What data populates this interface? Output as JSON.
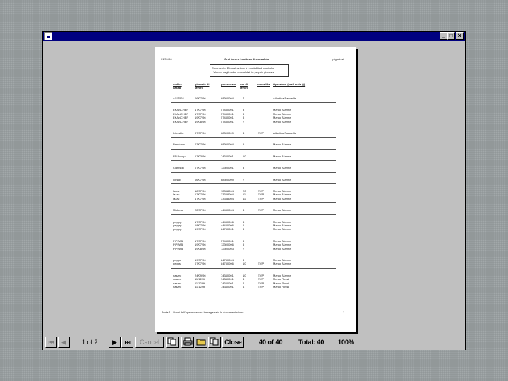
{
  "window": {
    "controls": {
      "minimize": "_",
      "maximize": "□",
      "close": "✕"
    }
  },
  "report": {
    "date": "01/01/96",
    "title": "Ordi lavoro in attesa di convalida",
    "code": "rptguaissi",
    "note_line1": "Commento: Dimostrazione in modalità di controllo",
    "note_line2": "L'elenco degli ordini convalidati in proprio giornata",
    "headers": {
      "code": "codice cassa",
      "day": "giornata di lavoro",
      "process": "processato",
      "hours": "ore di lavoro",
      "validated": "convalida",
      "operator": "Operatore (reali mais ())"
    },
    "groups": [
      {
        "rows": [
          [
            "ACIT564",
            "06/07/96",
            "68300004",
            "7",
            "",
            "Atlantica Panqelite"
          ]
        ]
      },
      {
        "rows": [
          [
            "EKANCHEP",
            "17/07/96",
            "57430001",
            "3",
            "",
            "Marco Allarme"
          ],
          [
            "EKANCHEP",
            "17/07/96",
            "57430001",
            "8",
            "",
            "Marco Allarme"
          ],
          [
            "EKANCHEP",
            "19/07/96",
            "57430001",
            "8",
            "",
            "Marco Allarme"
          ],
          [
            "EKANCHEP",
            "19/08/96",
            "57430001",
            "7",
            "",
            "Marco Allarme"
          ]
        ]
      },
      {
        "rows": [
          [
            "Interakte",
            "07/07/96",
            "68300009",
            "4",
            "EVIP",
            "Atlantica Panqelite"
          ]
        ]
      },
      {
        "rows": [
          [
            "Pandoras",
            "07/07/96",
            "68300004",
            "5",
            "",
            "Marco Allarme"
          ]
        ]
      },
      {
        "rows": [
          [
            "FRIAccep",
            "17/03/96",
            "74340001",
            "10",
            "",
            "Marco Allarme"
          ]
        ]
      },
      {
        "rows": [
          [
            "Clarkson",
            "07/07/96",
            "12300001",
            "3",
            "",
            "Marco Allarme"
          ]
        ]
      },
      {
        "rows": [
          [
            "Ivesrig",
            "06/07/96",
            "68300009",
            "7",
            "",
            "Marco Allarme"
          ]
        ]
      },
      {
        "rows": [
          [
            "Iazaz",
            "18/07/96",
            "12338004",
            "20",
            "EVIP",
            "Marco Allarme"
          ],
          [
            "Iazaz",
            "17/07/96",
            "33338004",
            "11",
            "EVIP",
            "Marco Allarme"
          ],
          [
            "Iazaz",
            "17/07/96",
            "33338004",
            "11",
            "EVIP",
            "Marco Allarme"
          ]
        ]
      },
      {
        "rows": [
          [
            "Mikkeus",
            "22/07/96",
            "44430004",
            "4",
            "EVIP",
            "Marco Allarme"
          ]
        ]
      },
      {
        "rows": [
          [
            "pepprp",
            "17/07/96",
            "44430006",
            "4",
            "",
            "Marco Allarme"
          ],
          [
            "pepprp",
            "18/07/96",
            "44430006",
            "6",
            "",
            "Marco Allarme"
          ],
          [
            "pepprp",
            "19/07/96",
            "84730001",
            "3",
            "",
            "Marco Allarme"
          ]
        ]
      },
      {
        "rows": [
          [
            "PIPPAB",
            "17/07/96",
            "57430001",
            "3",
            "",
            "Marco Allarme"
          ],
          [
            "PIPPAB",
            "19/07/96",
            "12300006",
            "5",
            "",
            "Marco Allarme"
          ],
          [
            "PIPPAB",
            "19/08/96",
            "12300003",
            "7",
            "",
            "Marco Allarme"
          ]
        ]
      },
      {
        "rows": [
          [
            "pepps",
            "19/07/96",
            "84730004",
            "3",
            "",
            "Marco Allarme"
          ],
          [
            "pepps",
            "07/07/96",
            "84730006",
            "10",
            "EVIP",
            "Marco Allarme"
          ]
        ]
      },
      {
        "rows": [
          [
            "nasaro",
            "24/09/96",
            "74340001",
            "10",
            "EVIP",
            "Marco Allarme"
          ],
          [
            "nasaro",
            "11/12/96",
            "74340001",
            "4",
            "EVIP",
            "Marco Rossi"
          ],
          [
            "nasaro",
            "11/12/96",
            "74340001",
            "4",
            "EVIP",
            "Marco Rossi"
          ],
          [
            "nasaro",
            "11/12/96",
            "74340001",
            "4",
            "EVIP",
            "Marco Rossi"
          ]
        ]
      }
    ],
    "footer_note": "Nota 1 - Nomi dell'operatore che ha registrato la documentazione",
    "footer_page": "1"
  },
  "toolbar": {
    "first": "⏮",
    "prev": "◀",
    "page_indicator": "1 of 2",
    "next": "▶",
    "last": "⏭",
    "cancel": "Cancel",
    "close": "Close",
    "record_count": "40 of 40",
    "total": "Total: 40",
    "zoom": "100%"
  }
}
